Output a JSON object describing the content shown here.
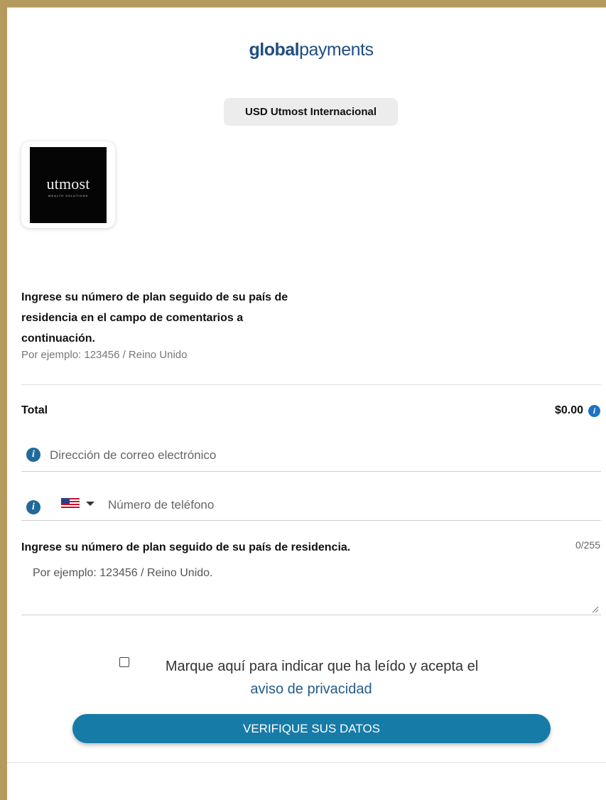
{
  "header": {
    "brand_bold": "global",
    "brand_light": "payments"
  },
  "merchant": {
    "name": "USD Utmost Internacional",
    "logo_text": "utmost",
    "logo_subtext": "WEALTH SOLUTIONS"
  },
  "instructions": {
    "text": "Ingrese su número de plan seguido de su país de residencia en el campo de comentarios a continuación.",
    "example": "Por ejemplo: 123456 / Reino Unido"
  },
  "total": {
    "label": "Total",
    "amount": "$0.00",
    "info_icon": "info-icon"
  },
  "email": {
    "placeholder": "Dirección de correo electrónico",
    "value": ""
  },
  "phone": {
    "country": "US",
    "placeholder": "Número de teléfono",
    "value": ""
  },
  "comments": {
    "label": "Ingrese su número de plan seguido de su país de residencia.",
    "counter": "0/255",
    "placeholder": "Por ejemplo: 123456 / Reino Unido.",
    "value": ""
  },
  "consent": {
    "text": "Marque aquí para indicar que ha leído y acepta el",
    "link_text": "aviso de privacidad",
    "checked": false
  },
  "submit": {
    "label": "VERIFIQUE SUS DATOS"
  },
  "colors": {
    "frame": "#b49a5c",
    "brand": "#1f4e82",
    "button": "#177ba8",
    "info": "#1c72c5",
    "link": "#245b8a"
  }
}
